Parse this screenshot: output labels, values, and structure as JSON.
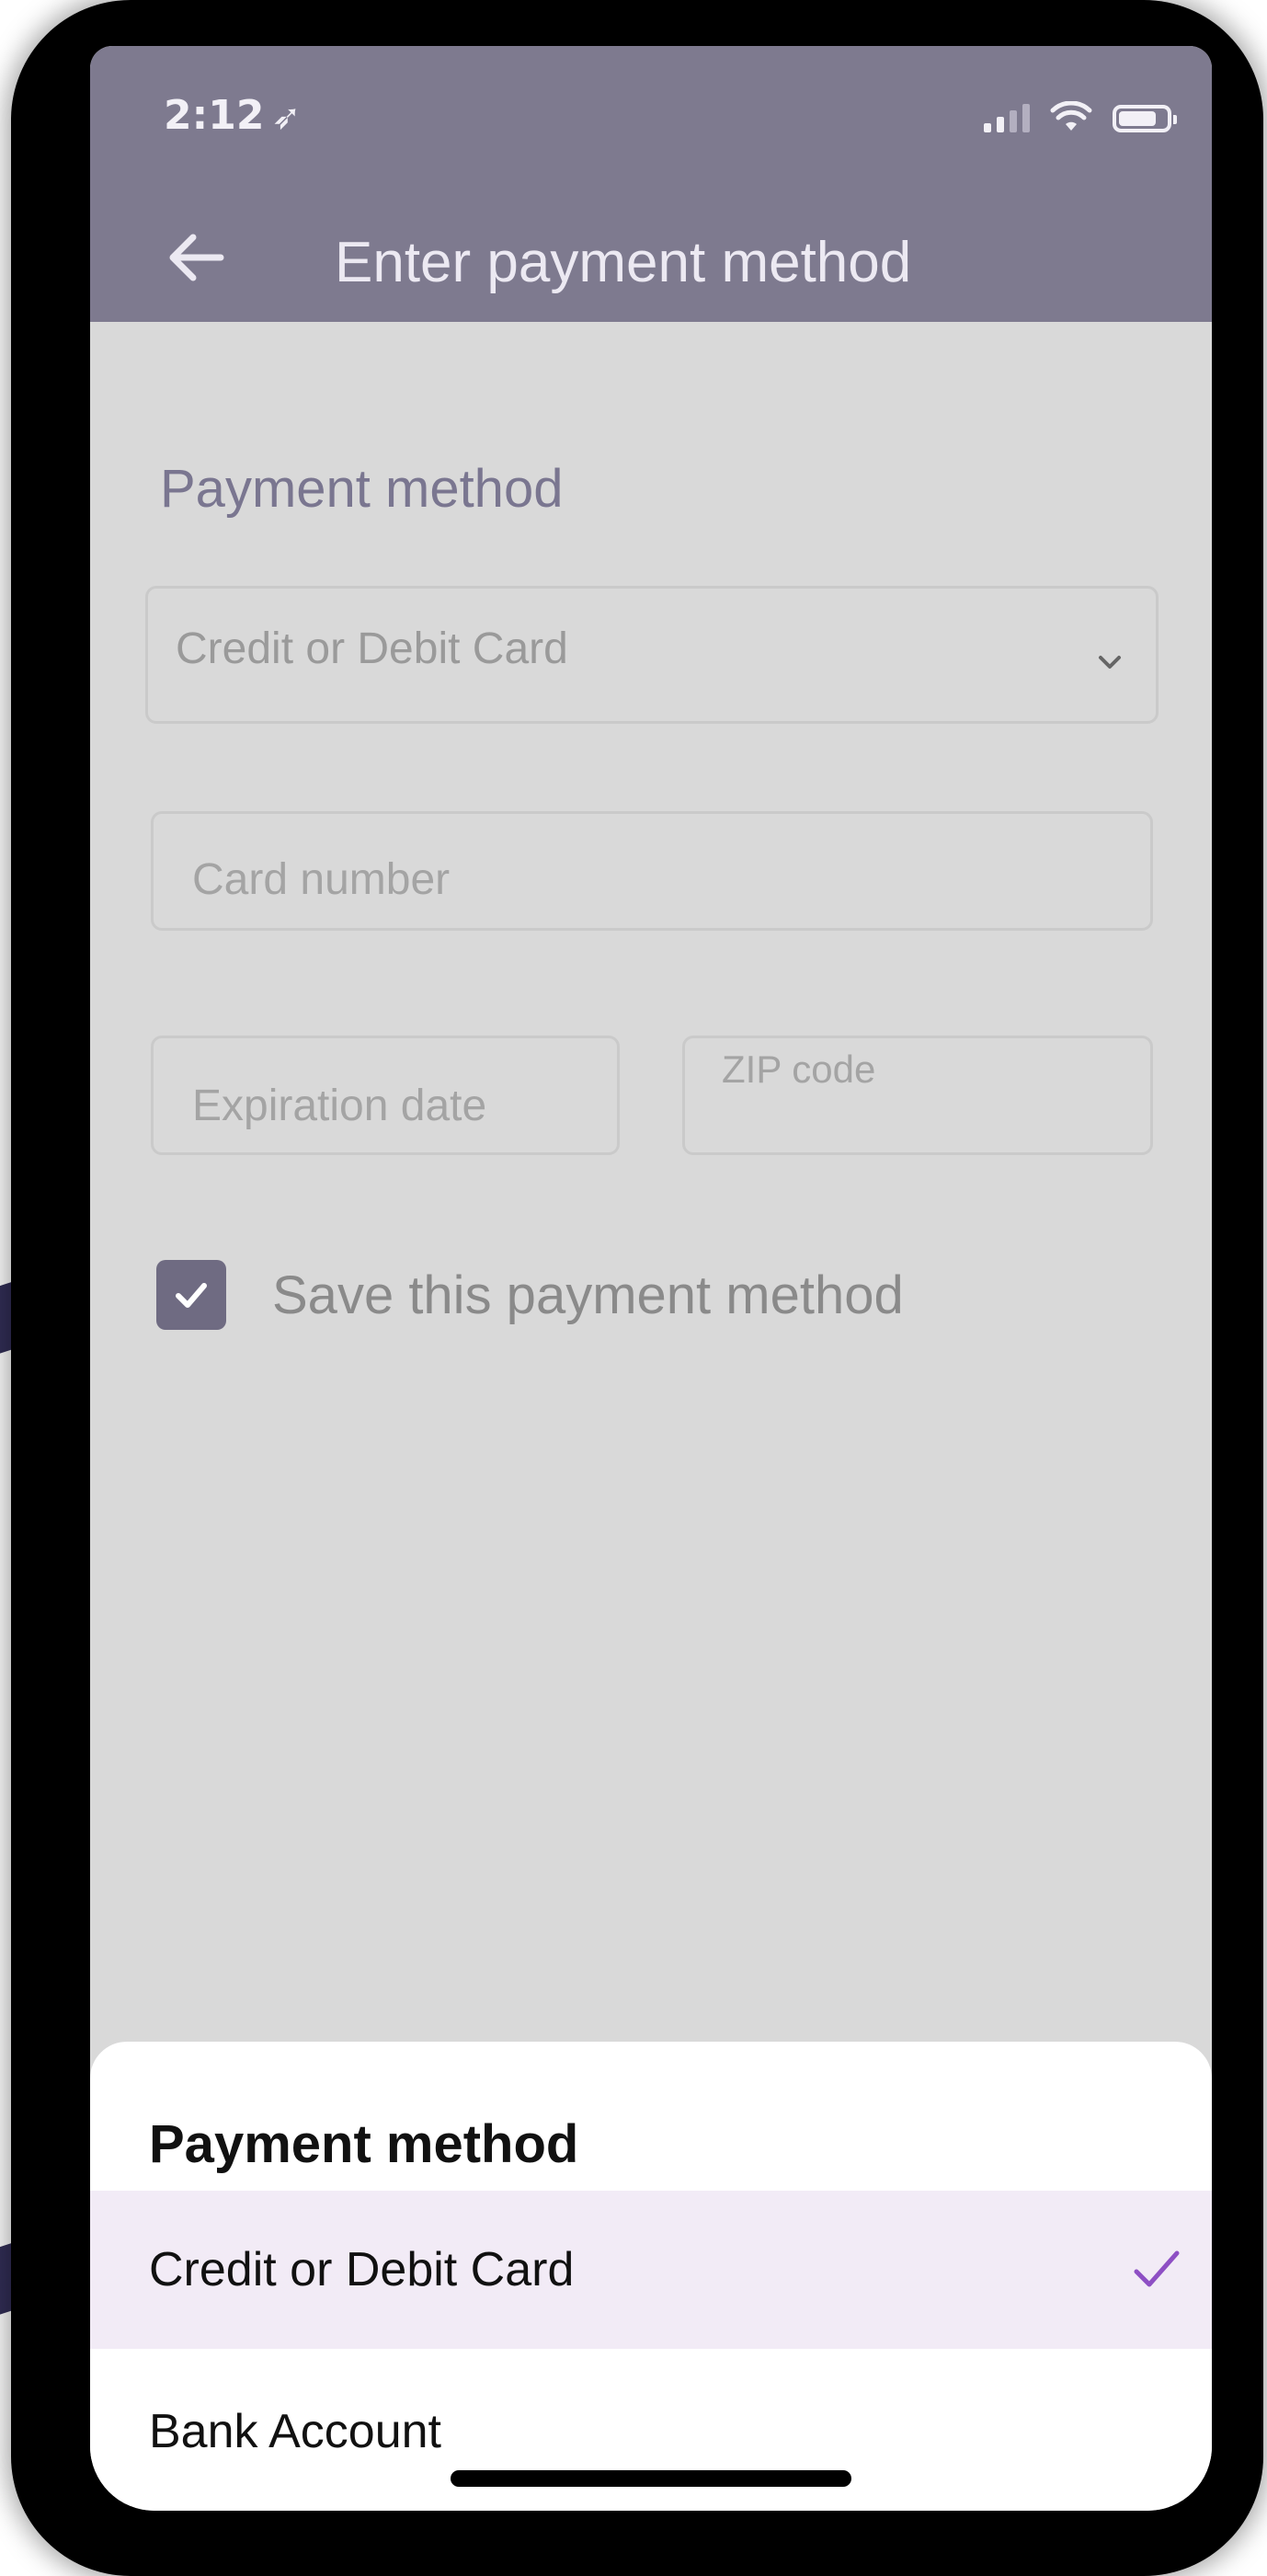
{
  "status_bar": {
    "time": "2:12",
    "location_glyph": "➶",
    "icons": [
      "cellular-signal-icon",
      "wifi-icon",
      "battery-icon"
    ]
  },
  "header": {
    "title": "Enter payment method",
    "back_icon": "arrow-left-icon"
  },
  "form": {
    "section_label": "Payment method",
    "payment_select": {
      "value": "Credit or Debit Card",
      "icon": "chevron-down-icon"
    },
    "card_number": {
      "placeholder": "Card number"
    },
    "expiration_date": {
      "placeholder": "Expiration date"
    },
    "zip_code": {
      "placeholder": "ZIP code"
    },
    "save_checkbox": {
      "label": "Save this payment method",
      "checked": true
    }
  },
  "sheet": {
    "title": "Payment method",
    "options": [
      {
        "label": "Credit or Debit Card",
        "selected": true
      },
      {
        "label": "Bank Account",
        "selected": false
      }
    ]
  },
  "colors": {
    "header_bg": "#7e7a8f",
    "dim_bg": "#d9d9d9",
    "selected_row_bg": "#f2ebf6",
    "check_accent": "#8e4fc4",
    "checkbox_fill": "#6f6b82",
    "annotation_arrow": "#322e57"
  }
}
